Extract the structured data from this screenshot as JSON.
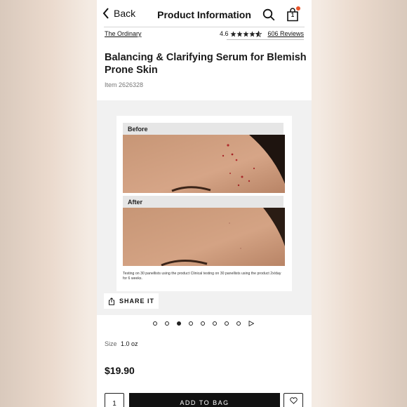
{
  "nav": {
    "back_label": "Back",
    "title": "Product Information",
    "bag_count": "1"
  },
  "product": {
    "brand": "The Ordinary",
    "rating": "4.6",
    "rating_value": 4.6,
    "reviews": "606 Reviews",
    "title": "Balancing & Clarifying Serum for Blemish Prone Skin",
    "item_number": "Item 2626328"
  },
  "gallery": {
    "before_label": "Before",
    "after_label": "After",
    "caption": "Testing on 30 panellists using the product Clinical testing on 30 panellists using the product 2x/day for 6 weeks.",
    "share_label": "SHARE IT",
    "slide_count": 8,
    "active_index": 2
  },
  "size": {
    "label": "Size",
    "value": "1.0 oz"
  },
  "price": "$19.90",
  "purchase": {
    "quantity": "1",
    "add_label": "ADD TO BAG"
  },
  "colors": {
    "accent_dot": "#e8542b",
    "button_bg": "#111111"
  },
  "icons": [
    "chevron-left-icon",
    "search-icon",
    "shopping-bag-icon",
    "star-icon",
    "share-icon",
    "play-icon",
    "heart-icon"
  ]
}
